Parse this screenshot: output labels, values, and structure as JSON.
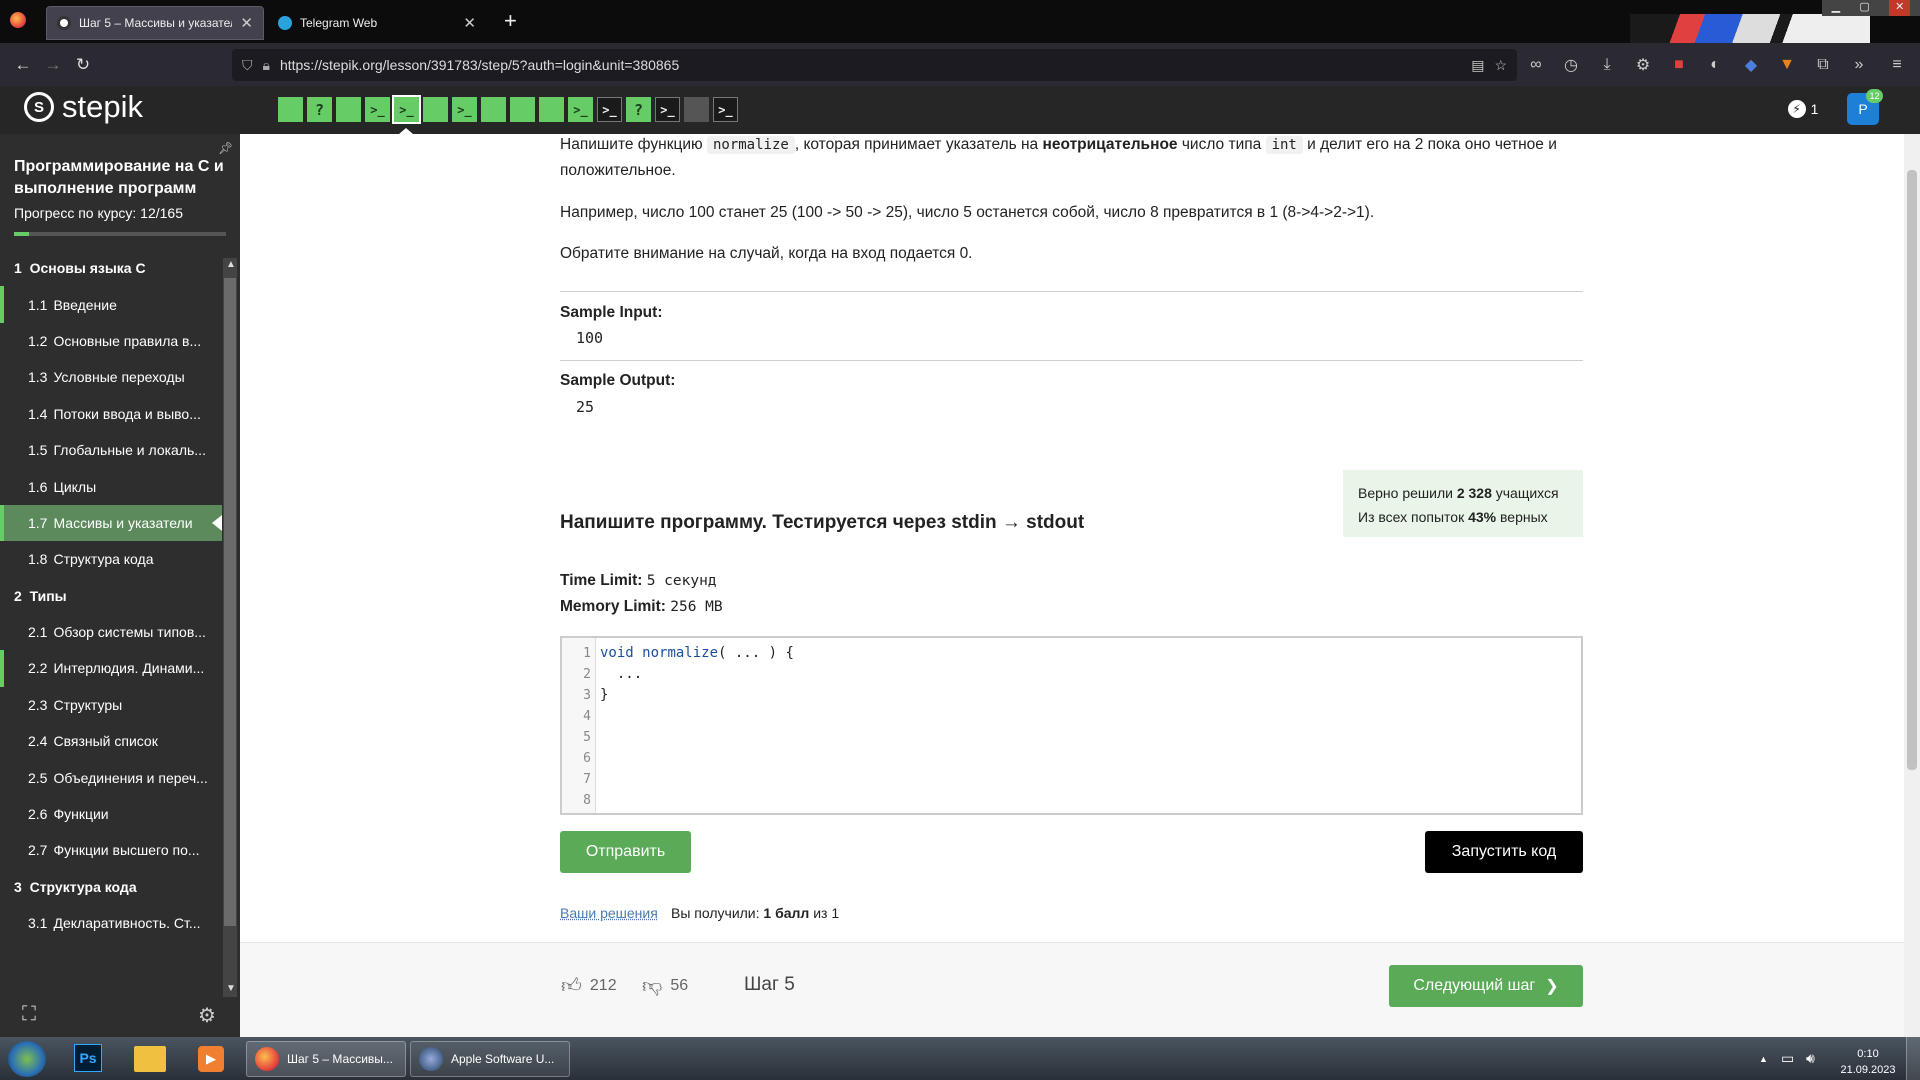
{
  "browser": {
    "tabs": [
      {
        "title": "Шаг 5 – Массивы и указатели",
        "close": "✕"
      },
      {
        "title": "Telegram Web",
        "close": "✕"
      }
    ],
    "new_tab": "+",
    "url": "https://stepik.org/lesson/391783/step/5?auth=login&unit=380865"
  },
  "header": {
    "logo_text": "stepik",
    "streak_count": "1",
    "avatar_letter": "P",
    "notif_count": "12",
    "step_icons": [
      "",
      "?",
      "",
      ">_",
      ">_",
      "",
      ">_",
      "",
      "",
      "",
      ">_",
      ">_",
      "?",
      ">_",
      "",
      ">_"
    ]
  },
  "sidebar": {
    "course_title": "Программирование на С и выполнение программ",
    "progress_label": "Прогресс по курсу:",
    "progress_value": "12/165",
    "progress_fraction": 0.073,
    "modules": [
      {
        "num": "1",
        "title": "Основы языка С",
        "items": [
          {
            "num": "1.1",
            "title": "Введение"
          },
          {
            "num": "1.2",
            "title": "Основные правила в..."
          },
          {
            "num": "1.3",
            "title": "Условные переходы"
          },
          {
            "num": "1.4",
            "title": "Потоки ввода и выво..."
          },
          {
            "num": "1.5",
            "title": "Глобальные и локаль..."
          },
          {
            "num": "1.6",
            "title": "Циклы"
          },
          {
            "num": "1.7",
            "title": "Массивы и указатели"
          },
          {
            "num": "1.8",
            "title": "Структура кода"
          }
        ]
      },
      {
        "num": "2",
        "title": "Типы",
        "items": [
          {
            "num": "2.1",
            "title": "Обзор системы типов..."
          },
          {
            "num": "2.2",
            "title": "Интерлюдия. Динами..."
          },
          {
            "num": "2.3",
            "title": "Структуры"
          },
          {
            "num": "2.4",
            "title": "Связный список"
          },
          {
            "num": "2.5",
            "title": "Объединения и переч..."
          },
          {
            "num": "2.6",
            "title": "Функции"
          },
          {
            "num": "2.7",
            "title": "Функции высшего по..."
          }
        ]
      },
      {
        "num": "3",
        "title": "Структура кода",
        "items": [
          {
            "num": "3.1",
            "title": "Декларативность. Ст..."
          }
        ]
      }
    ]
  },
  "task": {
    "p1_a": "Напишите функцию",
    "p1_code1": "normalize",
    "p1_b": ", которая принимает указатель на",
    "p1_bold": "неотрицательное",
    "p1_c": "число типа",
    "p1_code2": "int",
    "p1_d": "и делит его на 2 пока оно четное и положительное.",
    "p2": "Например, число 100 станет 25 (100 -> 50 -> 25), число 5 останется собой, число 8 превратится в 1 (8->4->2->1).",
    "p3": "Обратите внимание на случай, когда на вход подается 0.",
    "sample_input_label": "Sample Input:",
    "sample_input": "100",
    "sample_output_label": "Sample Output:",
    "sample_output": "25"
  },
  "stats": {
    "line1_a": "Верно решили",
    "line1_b": "2 328",
    "line1_c": "учащихся",
    "line2_a": "Из всех попыток",
    "line2_b": "43%",
    "line2_c": "верных"
  },
  "program": {
    "heading": "Напишите программу. Тестируется через stdin → stdout",
    "time_label": "Time Limit:",
    "time_value": "5 секунд",
    "mem_label": "Memory Limit:",
    "mem_value": "256 MB",
    "line_numbers": "1\n2\n3\n4\n5\n6\n7\n8",
    "code_kw": "void",
    "code_fn": "normalize",
    "code_rest1": "( ... ) {",
    "code_line2": "  ...",
    "code_line3": "}",
    "submit": "Отправить",
    "run": "Запустить код",
    "your_solutions": "Ваши решения",
    "score_a": "Вы получили:",
    "score_b": "1 балл",
    "score_c": "из 1"
  },
  "footer": {
    "likes": "212",
    "dislikes": "56",
    "step_label": "Шаг 5",
    "next": "Следующий шаг"
  },
  "taskbar": {
    "app1": "Шаг 5 – Массивы...",
    "app2": "Apple Software U...",
    "time": "0:10",
    "date": "21.09.2023"
  }
}
